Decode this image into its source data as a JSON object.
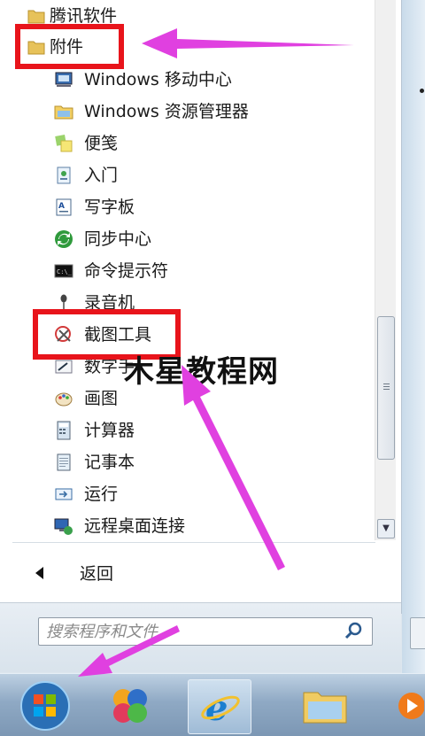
{
  "start_menu": {
    "folders": [
      {
        "label": "腾讯软件",
        "icon": "folder-icon"
      },
      {
        "label": "附件",
        "icon": "folder-icon"
      }
    ],
    "accessories": [
      {
        "label": "Windows 移动中心",
        "icon": "mobility-center-icon"
      },
      {
        "label": "Windows 资源管理器",
        "icon": "explorer-icon"
      },
      {
        "label": "便笺",
        "icon": "sticky-notes-icon"
      },
      {
        "label": "入门",
        "icon": "getting-started-icon"
      },
      {
        "label": "写字板",
        "icon": "wordpad-icon"
      },
      {
        "label": "同步中心",
        "icon": "sync-center-icon"
      },
      {
        "label": "命令提示符",
        "icon": "command-prompt-icon"
      },
      {
        "label": "录音机",
        "icon": "sound-recorder-icon"
      },
      {
        "label": "截图工具",
        "icon": "snipping-tool-icon"
      },
      {
        "label": "数字手",
        "icon": "math-input-icon"
      },
      {
        "label": "画图",
        "icon": "paint-icon"
      },
      {
        "label": "计算器",
        "icon": "calculator-icon"
      },
      {
        "label": "记事本",
        "icon": "notepad-icon"
      },
      {
        "label": "运行",
        "icon": "run-icon"
      },
      {
        "label": "远程桌面连接",
        "icon": "remote-desktop-icon"
      }
    ],
    "back_label": "返回",
    "search": {
      "placeholder": "搜索程序和文件"
    }
  },
  "watermark": "木星教程网",
  "taskbar": {
    "items": [
      "start-orb",
      "pinned-app",
      "internet-explorer",
      "windows-explorer",
      "media-player"
    ]
  },
  "colors": {
    "highlight": "#e8141b",
    "arrow": "#e040e0"
  }
}
